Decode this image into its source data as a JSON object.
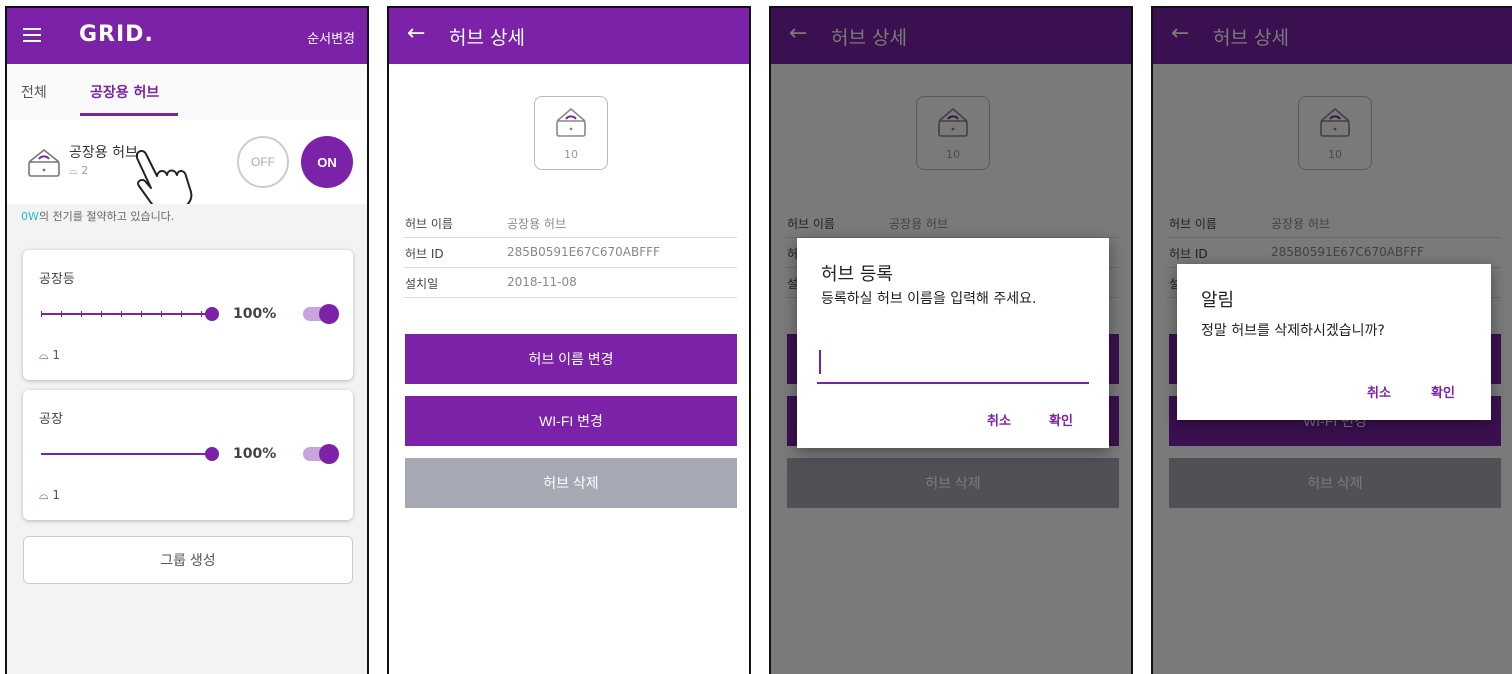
{
  "colors": {
    "primary": "#7b22a8",
    "accent": "#26b9c9",
    "disabled": "#a6a9b3"
  },
  "screen1": {
    "brand": "GRID.",
    "reorder": "순서변경",
    "tabs": [
      {
        "label": "전체"
      },
      {
        "label": "공장용 허브"
      }
    ],
    "hub": {
      "name": "공장용 허브",
      "device_count": "2",
      "off_label": "OFF",
      "on_label": "ON"
    },
    "saving": {
      "amount": "0W",
      "text": "의 전기를 절약하고 있습니다."
    },
    "groups": [
      {
        "name": "공장등",
        "level": "100%",
        "switch_on": true,
        "device_count": "1"
      },
      {
        "name": "공장",
        "level": "100%",
        "switch_on": true,
        "device_count": "1"
      }
    ],
    "create_group": "그룹 생성"
  },
  "detail": {
    "title": "허브 상세",
    "hub_number": "10",
    "rows": [
      {
        "label": "허브 이름",
        "value": "공장용 허브"
      },
      {
        "label": "허브 ID",
        "value": "285B0591E67C670ABFFF"
      },
      {
        "label": "설치일",
        "value": "2018-11-08"
      }
    ],
    "buttons": {
      "rename": "허브 이름 변경",
      "wifi": "WI-FI 변경",
      "delete": "허브 삭제"
    }
  },
  "register_dialog": {
    "title": "허브 등록",
    "message": "등록하실 허브 이름을 입력해 주세요.",
    "input_value": "",
    "cancel": "취소",
    "confirm": "확인"
  },
  "delete_dialog": {
    "title": "알림",
    "message": "정말 허브를 삭제하시겠습니까?",
    "cancel": "취소",
    "confirm": "확인"
  }
}
